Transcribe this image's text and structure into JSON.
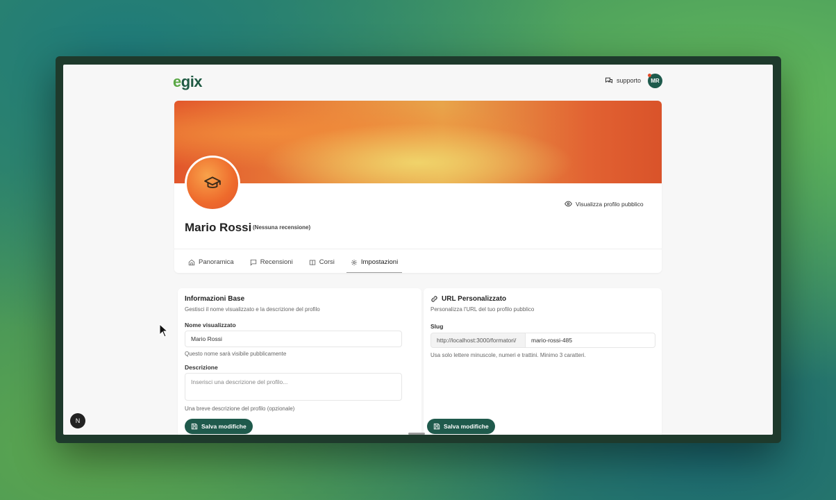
{
  "header": {
    "logo_e": "e",
    "logo_rest": "gix",
    "support_label": "supporto",
    "avatar_initials": "MR"
  },
  "profile": {
    "view_public_label": "Visualizza profilo pubblico",
    "name": "Mario Rossi",
    "reviews_note": "(Nessuna recensione)"
  },
  "tabs": [
    {
      "label": "Panoramica",
      "icon": "home-icon"
    },
    {
      "label": "Recensioni",
      "icon": "comment-icon"
    },
    {
      "label": "Corsi",
      "icon": "book-icon"
    },
    {
      "label": "Impostazioni",
      "icon": "gear-icon",
      "active": true
    }
  ],
  "basic_info": {
    "title": "Informazioni Base",
    "subtitle": "Gestisci il nome visualizzato e la descrizione del profilo",
    "display_name_label": "Nome visualizzato",
    "display_name_value": "Mario Rossi",
    "display_name_help": "Questo nome sarà visibile pubblicamente",
    "description_label": "Descrizione",
    "description_placeholder": "Inserisci una descrizione del profilo...",
    "description_help": "Una breve descrizione del profilo (opzionale)",
    "save_label": "Salva modifiche"
  },
  "custom_url": {
    "title": "URL Personalizzato",
    "subtitle": "Personalizza l'URL del tuo profilo pubblico",
    "slug_label": "Slug",
    "slug_prefix": "http://localhost:3000/formatori/",
    "slug_value": "mario-rossi-485",
    "slug_help": "Usa solo lettere minuscole, numeri e trattini. Minimo 3 caratteri.",
    "save_label": "Salva modifiche"
  },
  "misc": {
    "n_badge": "N"
  },
  "colors": {
    "brand": "#1f5a4c",
    "logo_green": "#5aa845"
  }
}
